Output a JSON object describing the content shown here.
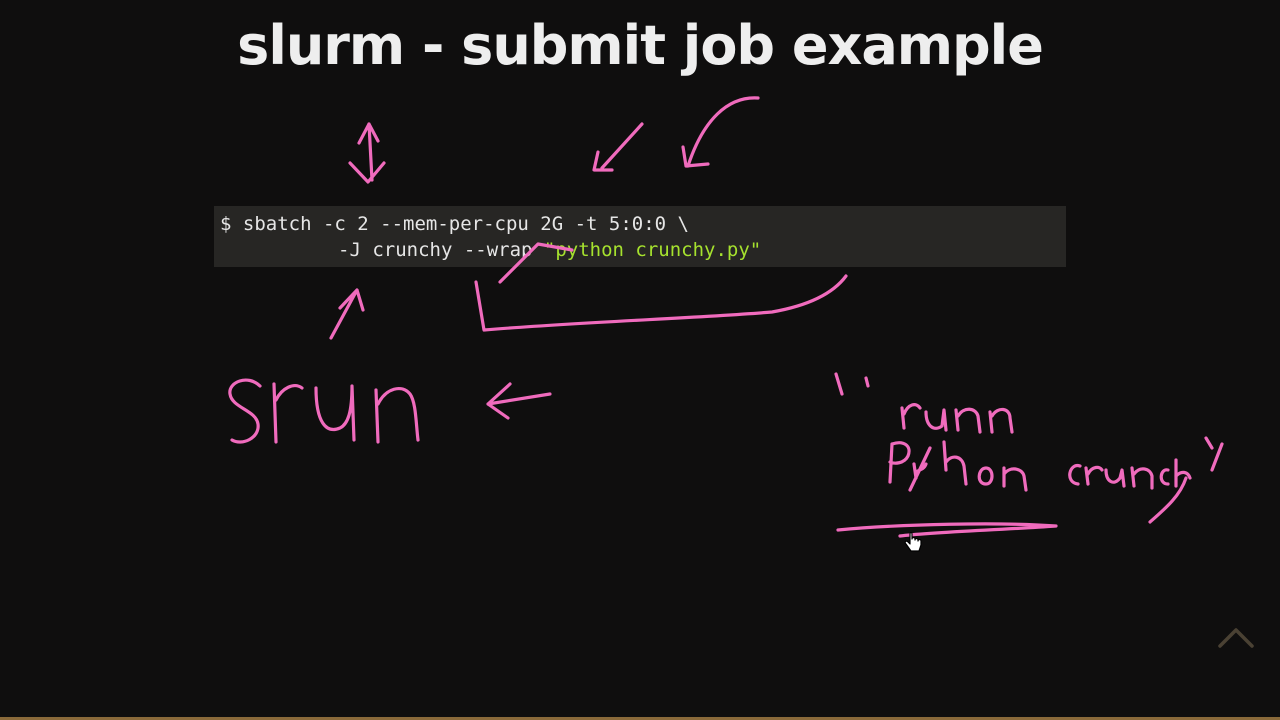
{
  "slide": {
    "title": "slurm - submit job example"
  },
  "code": {
    "line1": "$ sbatch -c 2 --mem-per-cpu 2G -t 5:0:0 \\",
    "line2_plain": "-J crunchy --wrap ",
    "line2_string": "\"python crunchy.py\""
  },
  "annotations": {
    "srun": "srun",
    "note_line1": "runn",
    "note_line2": "python crunchy",
    "ink_color": "#f06bbd"
  },
  "controls": {
    "scroll_to_top_icon": "chevron-up-icon",
    "cursor_icon": "hand-pointer-icon"
  },
  "theme": {
    "background": "#0f0e0e",
    "code_background": "#272624",
    "string_color": "#a6e22e",
    "bottom_bar_color": "#8a6a3a"
  }
}
